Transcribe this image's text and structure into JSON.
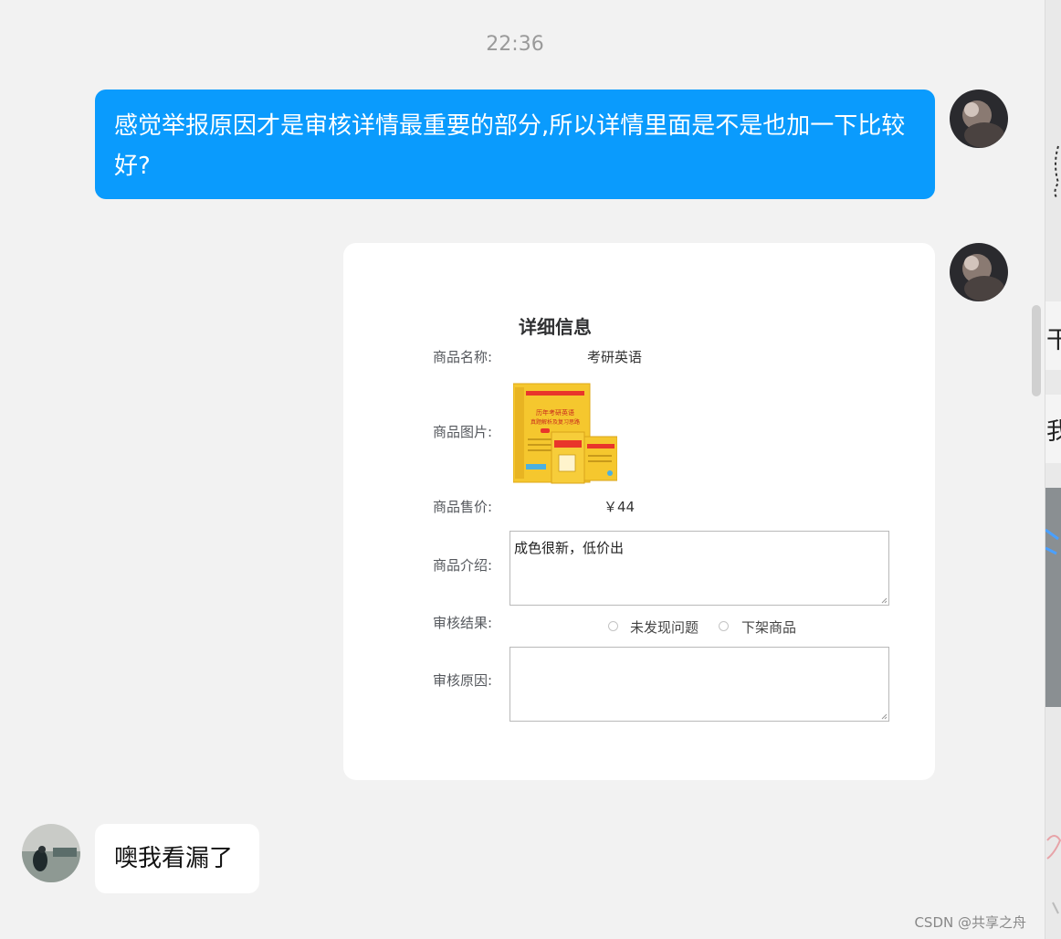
{
  "timestamp": "22:36",
  "messages": {
    "outgoing_text": "感觉举报原因才是审核详情最重要的部分,所以详情里面是不是也加一下比较好?",
    "incoming_text": "噢我看漏了"
  },
  "screenshot": {
    "title": "详细信息",
    "labels": {
      "name": "商品名称:",
      "image": "商品图片:",
      "price": "商品售价:",
      "intro": "商品介绍:",
      "result": "审核结果:",
      "reason": "审核原因:"
    },
    "name_value": "考研英语",
    "price_value": "￥44",
    "intro_value": "成色很新，低价出",
    "reason_value": "",
    "radio_options": [
      "未发现问题",
      "下架商品"
    ]
  },
  "book_image_text": {
    "line1": "历年考研英语",
    "line2": "真题解析及复习思路"
  },
  "sidebar_fragments": [
    "干",
    "我"
  ],
  "watermark": "CSDN @共享之舟",
  "colors": {
    "outgoing_bubble": "#0a9bfd",
    "incoming_bubble": "#ffffff",
    "background": "#f2f2f2",
    "book_yellow": "#f5c72e"
  }
}
